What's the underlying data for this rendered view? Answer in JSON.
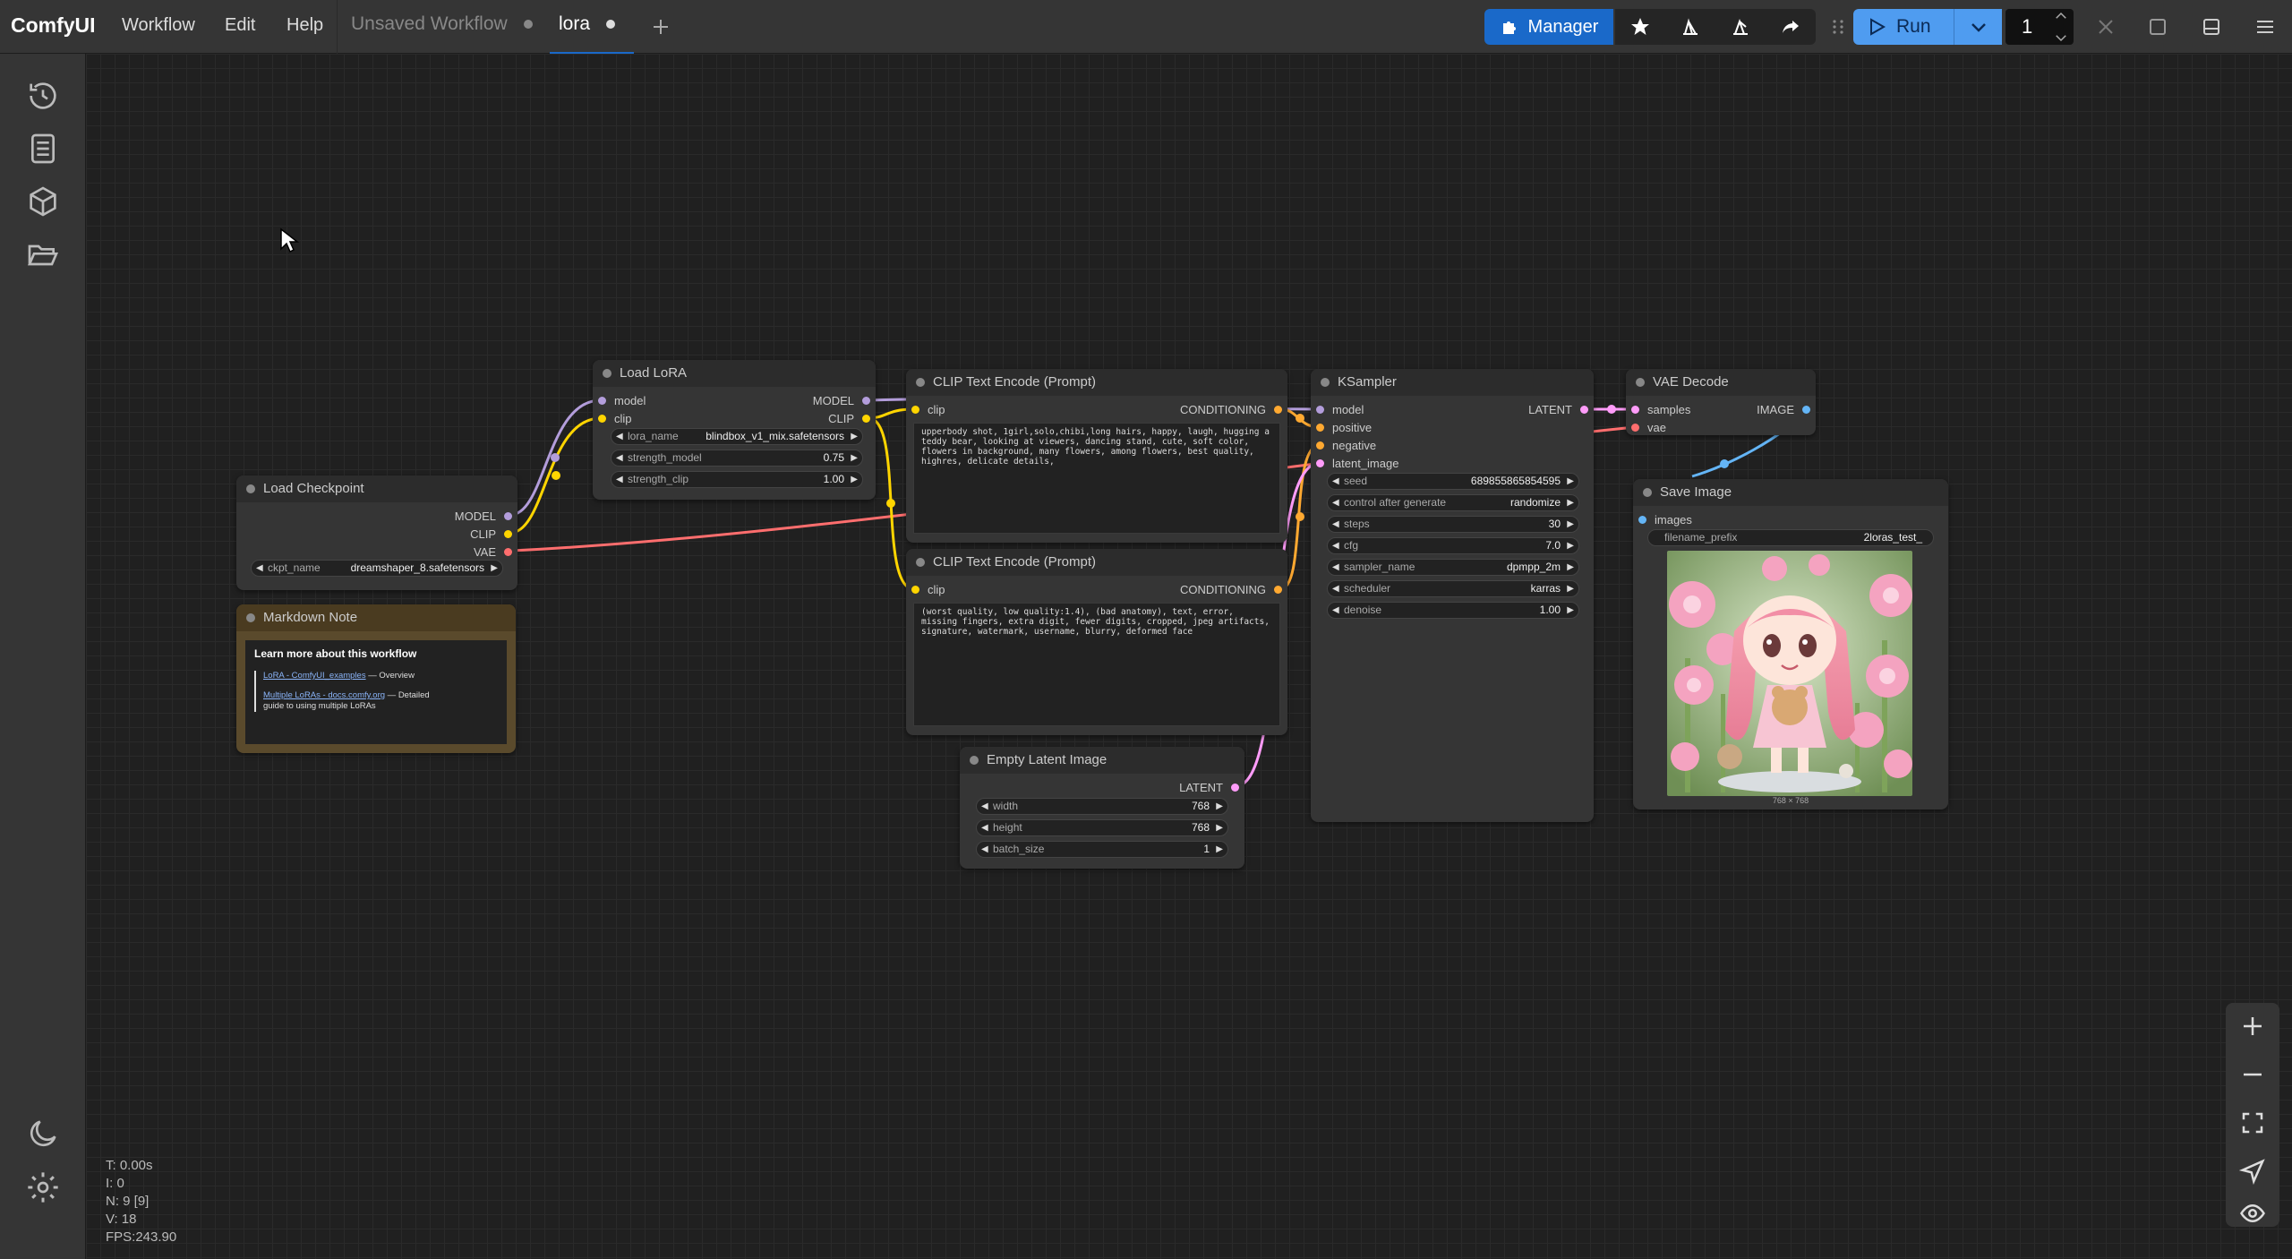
{
  "topbar": {
    "brand": "ComfyUI",
    "menus": [
      "Workflow",
      "Edit",
      "Help"
    ],
    "tabs": [
      {
        "label": "Unsaved Workflow",
        "active": false
      },
      {
        "label": "lora",
        "active": true
      }
    ],
    "manager_label": "Manager",
    "run_label": "Run",
    "queue_count": "1",
    "accent": "#1a69c9"
  },
  "sidebar": {
    "top_icons": [
      "history-icon",
      "document-icon",
      "cube-icon",
      "folder-open-icon"
    ],
    "bottom_icons": [
      "moon-icon",
      "gear-icon"
    ]
  },
  "nodes": {
    "load_checkpoint": {
      "title": "Load Checkpoint",
      "outputs": [
        "MODEL",
        "CLIP",
        "VAE"
      ],
      "widget": {
        "label": "ckpt_name",
        "value": "dreamshaper_8.safetensors"
      }
    },
    "markdown_note": {
      "title": "Markdown Note",
      "heading": "Learn more about this workflow",
      "link1": "LoRA - ComfyUI_examples",
      "link1_rest": " — Overview",
      "link2": "Multiple LoRAs - docs.comfy.org",
      "link2_rest": " — Detailed",
      "link2_cont": "guide to using multiple LoRAs"
    },
    "load_lora": {
      "title": "Load LoRA",
      "inputs": [
        "model",
        "clip"
      ],
      "outputs": [
        "MODEL",
        "CLIP"
      ],
      "widgets": [
        {
          "label": "lora_name",
          "value": "blindbox_v1_mix.safetensors"
        },
        {
          "label": "strength_model",
          "value": "0.75"
        },
        {
          "label": "strength_clip",
          "value": "1.00"
        }
      ]
    },
    "clip_pos": {
      "title": "CLIP Text Encode (Prompt)",
      "input": "clip",
      "output": "CONDITIONING",
      "text": "upperbody shot, 1girl,solo,chibi,long hairs, happy, laugh, hugging a teddy bear, looking at viewers, dancing stand, cute, soft color, flowers in background, many flowers, among flowers, best quality, highres, delicate details,"
    },
    "clip_neg": {
      "title": "CLIP Text Encode (Prompt)",
      "input": "clip",
      "output": "CONDITIONING",
      "text": "(worst quality, low quality:1.4), (bad anatomy), text, error, missing fingers, extra digit, fewer digits, cropped, jpeg artifacts, signature, watermark, username, blurry, deformed face"
    },
    "ksampler": {
      "title": "KSampler",
      "inputs": [
        "model",
        "positive",
        "negative",
        "latent_image"
      ],
      "output": "LATENT",
      "widgets": [
        {
          "label": "seed",
          "value": "689855865854595"
        },
        {
          "label": "control after generate",
          "value": "randomize"
        },
        {
          "label": "steps",
          "value": "30"
        },
        {
          "label": "cfg",
          "value": "7.0"
        },
        {
          "label": "sampler_name",
          "value": "dpmpp_2m"
        },
        {
          "label": "scheduler",
          "value": "karras"
        },
        {
          "label": "denoise",
          "value": "1.00"
        }
      ]
    },
    "vae_decode": {
      "title": "VAE Decode",
      "inputs": [
        "samples",
        "vae"
      ],
      "output": "IMAGE"
    },
    "save_image": {
      "title": "Save Image",
      "input": "images",
      "widget": {
        "label": "filename_prefix",
        "value": "2loras_test_"
      },
      "image_size": "768 × 768"
    },
    "empty_latent": {
      "title": "Empty Latent Image",
      "output": "LATENT",
      "widgets": [
        {
          "label": "width",
          "value": "768"
        },
        {
          "label": "height",
          "value": "768"
        },
        {
          "label": "batch_size",
          "value": "1"
        }
      ]
    }
  },
  "stats": {
    "t": "T: 0.00s",
    "i": "I: 0",
    "n": "N: 9 [9]",
    "v": "V: 18",
    "fps": "FPS:243.90"
  },
  "colors": {
    "model": "#b39ddb",
    "clip": "#ffd500",
    "vae": "#ff6e6e",
    "conditioning": "#ffa931",
    "latent": "#ff9cf9",
    "image": "#64b5f6"
  }
}
